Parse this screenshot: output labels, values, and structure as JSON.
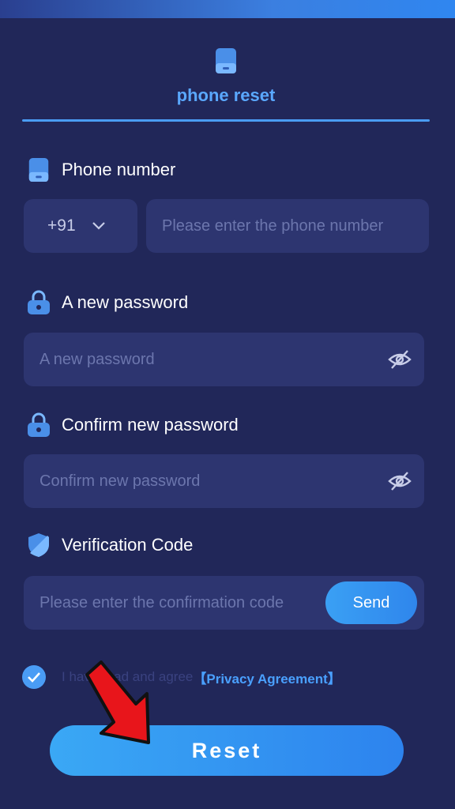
{
  "tab": {
    "label": "phone reset"
  },
  "phone": {
    "label": "Phone number",
    "country_code": "+91",
    "placeholder": "Please enter the phone number"
  },
  "new_password": {
    "label": "A new password",
    "placeholder": "A new password"
  },
  "confirm_password": {
    "label": "Confirm new password",
    "placeholder": "Confirm new password"
  },
  "verification": {
    "label": "Verification Code",
    "placeholder": "Please enter the confirmation code",
    "send_label": "Send"
  },
  "agreement": {
    "text": "I have read and agree",
    "link": "【Privacy Agreement】",
    "checked": true
  },
  "reset_label": "Reset",
  "colors": {
    "background": "#212759",
    "field": "#2d3570",
    "accent": "#4a9cf5",
    "arrow": "#e8151b"
  }
}
